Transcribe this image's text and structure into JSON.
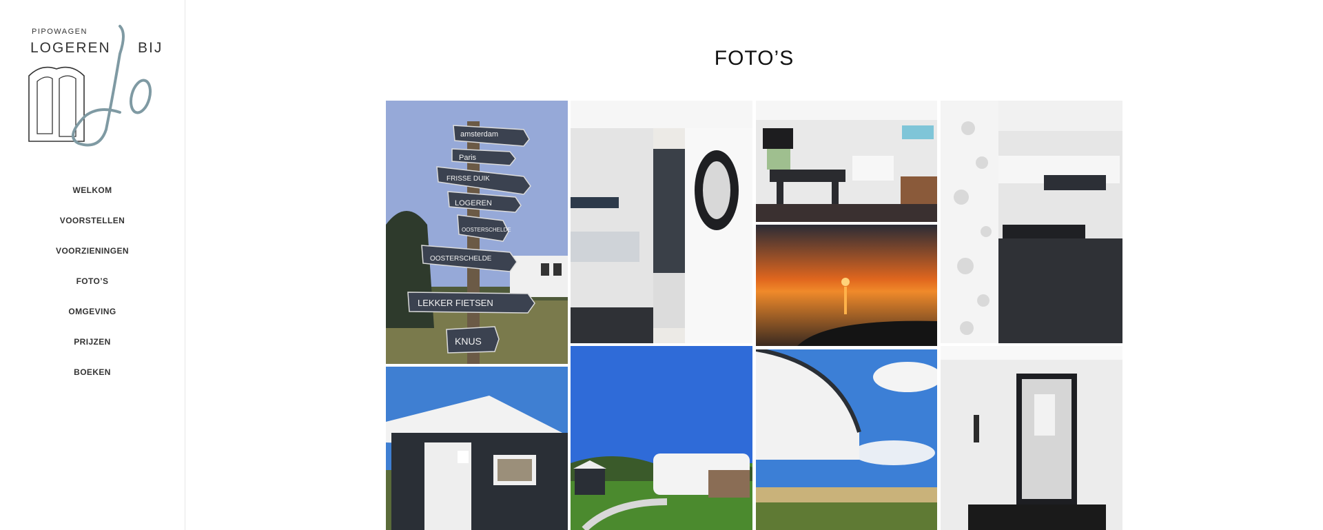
{
  "brand": {
    "small": "PIPOWAGEN",
    "line": "LOGEREN",
    "bij": "BIJ"
  },
  "nav": [
    "WELKOM",
    "VOORSTELLEN",
    "VOORZIENINGEN",
    "FOTO’S",
    "OMGEVING",
    "PRIJZEN",
    "BOEKEN"
  ],
  "page": {
    "title": "FOTO’S"
  },
  "signpost": [
    "amsterdam",
    "Paris",
    "FRISSE DUIK",
    "LOGEREN",
    "OOSTERSCHELDE",
    "OOSTERSCHELDE",
    "LEKKER FIETSEN",
    "KNUS"
  ],
  "colors": {
    "sky": "#8fa6d6",
    "dark": "#2a2f36",
    "accent": "#7f9aa3"
  }
}
